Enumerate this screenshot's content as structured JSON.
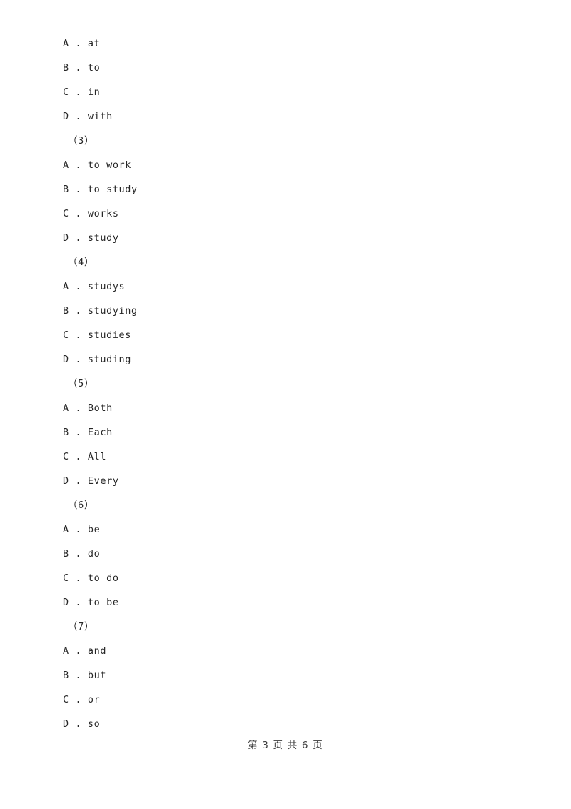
{
  "document": {
    "page_background": "#ffffff",
    "text_color": "#262626",
    "footer_color": "#3a3a3a"
  },
  "blocks": [
    {
      "type": "options",
      "items": [
        {
          "letter": "A",
          "separator": " . ",
          "text": "at"
        },
        {
          "letter": "B",
          "separator": " . ",
          "text": "to"
        },
        {
          "letter": "C",
          "separator": " . ",
          "text": "in"
        },
        {
          "letter": "D",
          "separator": " . ",
          "text": "with"
        }
      ]
    },
    {
      "type": "question_number",
      "label": "（3）"
    },
    {
      "type": "options",
      "items": [
        {
          "letter": "A",
          "separator": " . ",
          "text": "to work"
        },
        {
          "letter": "B",
          "separator": " . ",
          "text": "to study"
        },
        {
          "letter": "C",
          "separator": " . ",
          "text": "works"
        },
        {
          "letter": "D",
          "separator": " . ",
          "text": "study"
        }
      ]
    },
    {
      "type": "question_number",
      "label": "（4）"
    },
    {
      "type": "options",
      "items": [
        {
          "letter": "A",
          "separator": " . ",
          "text": "studys"
        },
        {
          "letter": "B",
          "separator": " . ",
          "text": "studying"
        },
        {
          "letter": "C",
          "separator": " . ",
          "text": "studies"
        },
        {
          "letter": "D",
          "separator": " . ",
          "text": "studing"
        }
      ]
    },
    {
      "type": "question_number",
      "label": "（5）"
    },
    {
      "type": "options",
      "items": [
        {
          "letter": "A",
          "separator": " . ",
          "text": "Both"
        },
        {
          "letter": "B",
          "separator": " . ",
          "text": "Each"
        },
        {
          "letter": "C",
          "separator": " . ",
          "text": "All"
        },
        {
          "letter": "D",
          "separator": " . ",
          "text": "Every"
        }
      ]
    },
    {
      "type": "question_number",
      "label": "（6）"
    },
    {
      "type": "options",
      "items": [
        {
          "letter": "A",
          "separator": " . ",
          "text": "be"
        },
        {
          "letter": "B",
          "separator": " . ",
          "text": "do"
        },
        {
          "letter": "C",
          "separator": " . ",
          "text": "to do"
        },
        {
          "letter": "D",
          "separator": " . ",
          "text": "to be"
        }
      ]
    },
    {
      "type": "question_number",
      "label": "（7）"
    },
    {
      "type": "options",
      "items": [
        {
          "letter": "A",
          "separator": " . ",
          "text": "and"
        },
        {
          "letter": "B",
          "separator": " . ",
          "text": "but"
        },
        {
          "letter": "C",
          "separator": " . ",
          "text": "or"
        },
        {
          "letter": "D",
          "separator": " . ",
          "text": "so"
        }
      ]
    }
  ],
  "footer": {
    "text": "第 3 页 共 6 页",
    "current_page": "3",
    "total_pages": "6"
  }
}
